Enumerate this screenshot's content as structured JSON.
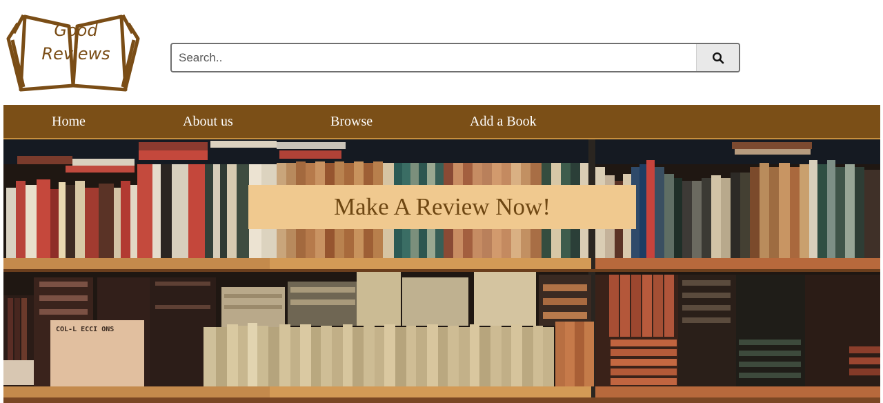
{
  "logo": {
    "line1": "Good",
    "line2": "Reviews"
  },
  "search": {
    "placeholder": "Search..",
    "value": "",
    "button_icon": "search-icon"
  },
  "nav": {
    "items": [
      {
        "label": "Home"
      },
      {
        "label": "About us"
      },
      {
        "label": "Browse"
      },
      {
        "label": "Add a Book"
      }
    ]
  },
  "hero": {
    "cta_label": "Make A Review Now!",
    "box_label": "COL-L ECCI ONS"
  },
  "colors": {
    "brand_brown": "#7b4f17",
    "cta_background": "#f0c98f",
    "cta_text": "#6e4713",
    "shelf_wood": "#c48a4c"
  }
}
